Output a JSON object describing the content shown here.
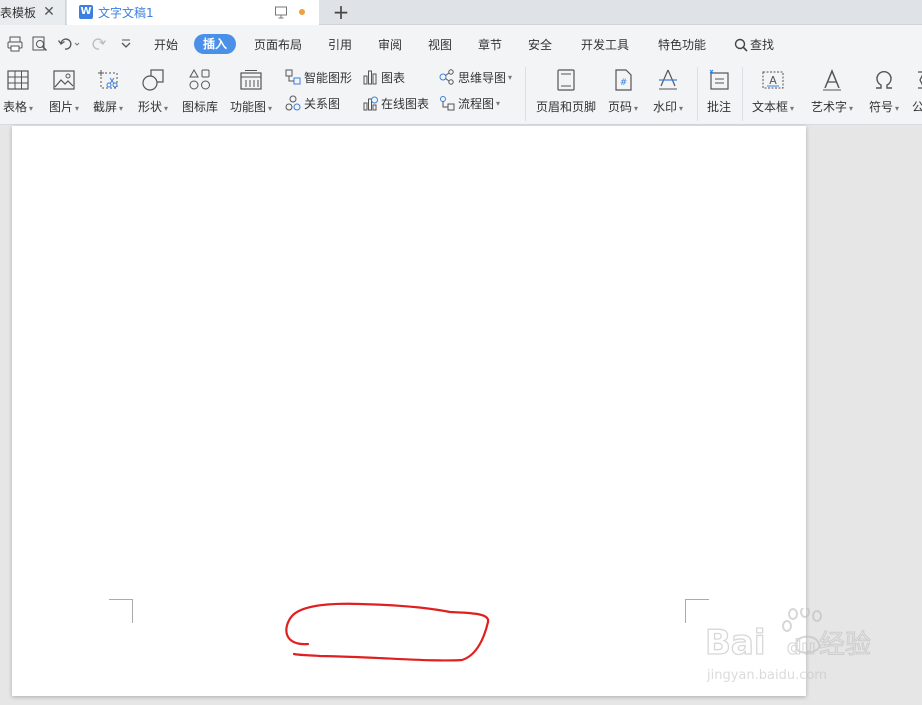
{
  "tabs": [
    {
      "label": "表模板"
    },
    {
      "label": "文字文稿1"
    }
  ],
  "tab_icon_letter": "W",
  "menu": {
    "items": [
      {
        "label": "开始"
      },
      {
        "label": "插入"
      },
      {
        "label": "页面布局"
      },
      {
        "label": "引用"
      },
      {
        "label": "审阅"
      },
      {
        "label": "视图"
      },
      {
        "label": "章节"
      },
      {
        "label": "安全"
      },
      {
        "label": "开发工具"
      },
      {
        "label": "特色功能"
      }
    ],
    "active": "插入",
    "search_label": "查找"
  },
  "ribbon": {
    "table": "表格",
    "picture": "图片",
    "screenshot": "截屏",
    "shape": "形状",
    "icon_library": "图标库",
    "function_chart": "功能图",
    "smart_graphic": "智能图形",
    "chart": "图表",
    "mind_map": "思维导图",
    "relation_chart": "关系图",
    "online_chart": "在线图表",
    "flowchart": "流程图",
    "header_footer": "页眉和页脚",
    "page_number": "页码",
    "watermark": "水印",
    "comment": "批注",
    "text_box": "文本框",
    "word_art": "艺术字",
    "symbol": "符号",
    "formula": "公"
  },
  "watermark": {
    "brand_main": "Bai",
    "brand_du": "du",
    "brand_cn": "经验",
    "url": "jingyan.baidu.com"
  },
  "colors": {
    "accent": "#4a8fe8",
    "tab_text": "#3b7fe0",
    "annotation": "#e02020",
    "unsaved_dot": "#f0a040"
  }
}
